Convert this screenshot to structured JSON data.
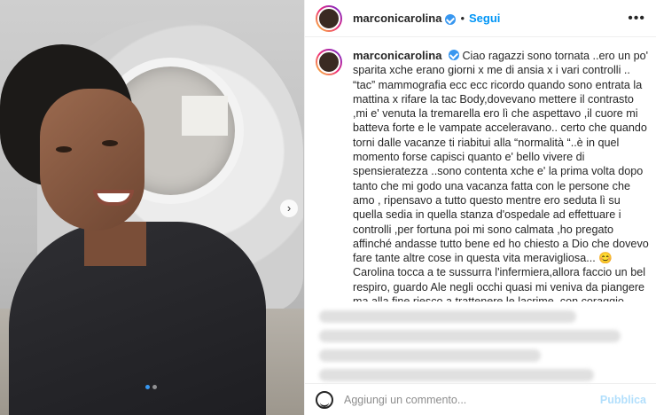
{
  "post": {
    "username": "marconicarolina",
    "separator": "•",
    "follow_label": "Segui",
    "more_label": "•••",
    "carousel_next": "›",
    "caption": "Ciao ragazzi sono tornata ..ero un po' sparita xche erano giorni x me di ansia x i vari controlli .. “tac” mammografia ecc ecc ricordo quando sono entrata la mattina x rifare la tac Body,dovevano mettere il contrasto ,mi e' venuta la tremarella ero lì che aspettavo ,il cuore mi batteva forte e le vampate acceleravano.. certo che quando torni dalle vacanze ti riabitui alla “normalità “..è in quel momento forse capisci quanto e' bello vivere di spensieratezza ..sono contenta xche e' la prima volta dopo tanto che mi godo una vacanza fatta con le persone che amo , ripensavo a tutto questo mentre ero seduta lì su quella sedia in quella stanza d'ospedale ad effettuare i controlli ,per fortuna poi mi sono calmata ,ho pregato affinché andasse tutto bene ed ho chiesto a Dio che dovevo fare tante altre cose in questa vita meravigliosa... 😊 Carolina tocca a te sussurra l'infermiera,allora faccio un bel respiro, guardo Ale negli occhi quasi mi veniva da piangere ma alla fine riesco a trattenere le lacrime ,con coraggio entro in quella sala così fredda 😅quasi sembrasse una cella frigorifera ..nessuno dovrebbe trovarsi in questo posto😞e nel mio"
  },
  "comment": {
    "placeholder": "Aggiungi un commento...",
    "publish_label": "Pubblica"
  }
}
